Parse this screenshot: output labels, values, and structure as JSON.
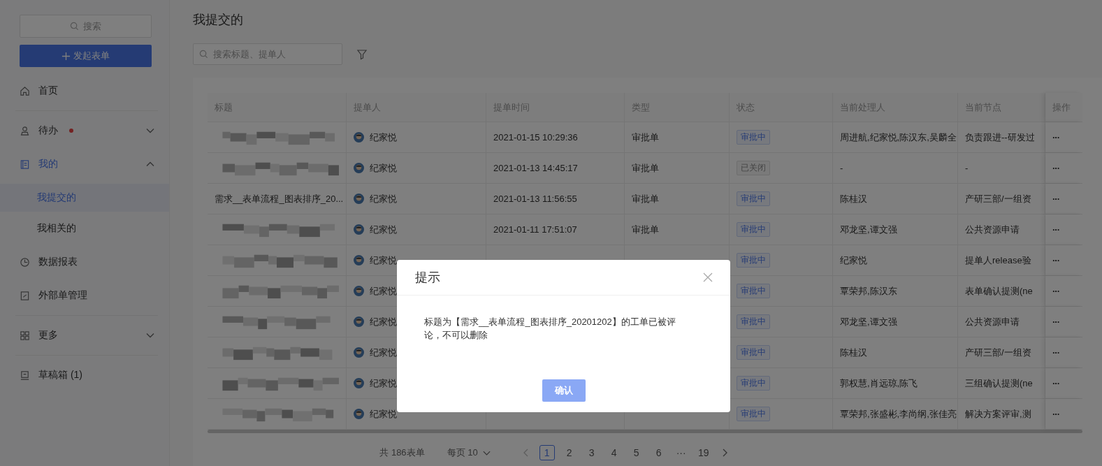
{
  "sidebar": {
    "search": {
      "placeholder": "搜索"
    },
    "create_button": "发起表单",
    "nav_groups": [
      [
        {
          "label": "首页",
          "selected": false
        }
      ],
      [
        {
          "label": "待办",
          "selected": false,
          "badge_dot": true,
          "expanded": false
        },
        {
          "label": "我的",
          "selected": true,
          "expanded": true,
          "children": [
            {
              "label": "我提交的",
              "selected": true
            },
            {
              "label": "我相关的",
              "selected": false
            }
          ]
        },
        {
          "label": "数据报表",
          "selected": false
        },
        {
          "label": "外部单管理",
          "selected": false
        }
      ],
      [
        {
          "label": "更多",
          "selected": false,
          "expanded": false
        }
      ],
      [
        {
          "label": "草稿箱 (1)",
          "selected": false
        }
      ]
    ]
  },
  "page_title": "我提交的",
  "search": {
    "placeholder": "搜索标题、提单人"
  },
  "table": {
    "columns": [
      "标题",
      "提单人",
      "提单时间",
      "类型",
      "状态",
      "当前处理人",
      "当前节点",
      "操作"
    ],
    "rows": [
      {
        "title_blurred": true,
        "submitter": "纪家悦",
        "time": "2021-01-15 10:29:36",
        "type": "审批单",
        "status": "审批中",
        "closed": false,
        "handlers": "周进航,纪家悦,陈汉东,吴麟全",
        "node": "负责跟进--研发过",
        "action": "···"
      },
      {
        "title_blurred": true,
        "submitter": "纪家悦",
        "time": "2021-01-13 14:45:17",
        "type": "审批单",
        "status": "已关闭",
        "closed": true,
        "handlers": "-",
        "node": "-",
        "action": "···"
      },
      {
        "title_blurred": false,
        "title": "需求__表单流程_图表排序_20...",
        "submitter": "纪家悦",
        "time": "2021-01-13 11:56:55",
        "type": "审批单",
        "status": "审批中",
        "closed": false,
        "handlers": "陈桂汉",
        "node": "产研三部/一组资",
        "action": "···"
      },
      {
        "title_blurred": true,
        "submitter": "纪家悦",
        "time": "2021-01-11 17:51:07",
        "type": "审批单",
        "status": "审批中",
        "closed": false,
        "handlers": "邓龙坚,谭文强",
        "node": "公共资源申请",
        "action": "···"
      },
      {
        "title_blurred": true,
        "submitter": "纪家悦",
        "status": "审批中",
        "closed": false,
        "handlers": "纪家悦",
        "node": "提单人release验",
        "action": "···"
      },
      {
        "title_blurred": true,
        "submitter": "纪家悦",
        "status": "审批中",
        "closed": false,
        "handlers": "覃荣邦,陈汉东",
        "node": "表单确认提测(ne",
        "action": "···"
      },
      {
        "title_blurred": true,
        "submitter": "纪家悦",
        "status": "审批中",
        "closed": false,
        "handlers": "邓龙坚,谭文强",
        "node": "公共资源申请",
        "action": "···"
      },
      {
        "title_blurred": true,
        "submitter": "纪家悦",
        "status": "审批中",
        "closed": false,
        "handlers": "陈桂汉",
        "node": "产研三部/一组资",
        "action": "···"
      },
      {
        "title_blurred": true,
        "submitter": "纪家悦",
        "status": "审批中",
        "closed": false,
        "handlers": "郭权慧,肖远琼,陈飞",
        "node": "三组确认提测(ne",
        "action": "···"
      },
      {
        "title_blurred": true,
        "submitter": "纪家悦",
        "status": "审批中",
        "closed": false,
        "handlers": "覃荣邦,张盛彬,李尚纲,张佳亮",
        "node": "解决方案评审,测",
        "action": "···"
      }
    ]
  },
  "pagination": {
    "total": "共 186表单",
    "page_size": "每页 10",
    "pages": [
      {
        "label": "1",
        "selected": true
      },
      {
        "label": "2",
        "selected": false
      },
      {
        "label": "3",
        "selected": false
      },
      {
        "label": "4",
        "selected": false
      },
      {
        "label": "5",
        "selected": false
      },
      {
        "label": "6",
        "selected": false
      },
      {
        "label": "···",
        "selected": false
      },
      {
        "label": "19",
        "selected": false
      }
    ]
  },
  "dialog": {
    "title": "提示",
    "message": "标题为【需求__表单流程_图表排序_20201202】的工单已被评论，不可以删除",
    "confirm": "确认"
  }
}
